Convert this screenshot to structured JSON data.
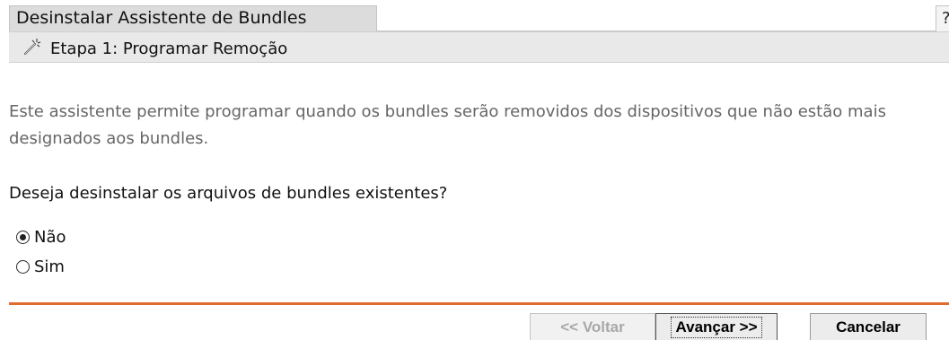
{
  "header": {
    "title": "Desinstalar Assistente de Bundles",
    "help_label": "?"
  },
  "step": {
    "icon": "wand-icon",
    "title": "Etapa 1: Programar Remoção"
  },
  "main": {
    "description": "Este assistente permite programar quando os bundles serão removidos dos dispositivos que não estão mais designados aos bundles.",
    "question": "Deseja desinstalar os arquivos de bundles existentes?",
    "options": [
      {
        "label": "Não",
        "selected": true
      },
      {
        "label": "Sim",
        "selected": false
      }
    ]
  },
  "footer": {
    "back_label": "<< Voltar",
    "next_label": "Avançar >>",
    "cancel_label": "Cancelar",
    "accent_color": "#e06d2e"
  }
}
